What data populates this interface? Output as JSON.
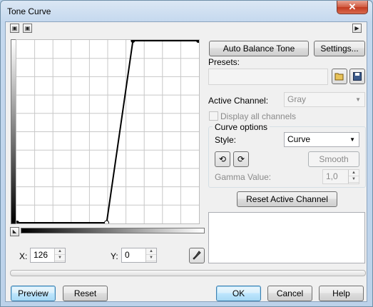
{
  "window": {
    "title": "Tone Curve",
    "close_glyph": "✕"
  },
  "toolbar": {
    "left_icon1": "▣",
    "left_icon2": "▣",
    "right_icon": "▶"
  },
  "buttons": {
    "auto_balance": "Auto Balance Tone",
    "settings": "Settings...",
    "smooth": "Smooth",
    "reset_channel": "Reset Active Channel",
    "preview": "Preview",
    "reset": "Reset",
    "ok": "OK",
    "cancel": "Cancel",
    "help": "Help"
  },
  "presets": {
    "label": "Presets:",
    "value": ""
  },
  "channel": {
    "label": "Active Channel:",
    "value": "Gray",
    "display_all": "Display all channels"
  },
  "curve_options": {
    "title": "Curve options",
    "style_label": "Style:",
    "style_value": "Curve",
    "gamma_label": "Gamma Value:",
    "gamma_value": "1,0"
  },
  "coords": {
    "x_label": "X:",
    "x_value": "126",
    "y_label": "Y:",
    "y_value": "0"
  },
  "curve": {
    "points": [
      [
        0,
        0
      ],
      [
        126,
        0
      ],
      [
        163,
        255
      ],
      [
        255,
        255
      ]
    ]
  }
}
